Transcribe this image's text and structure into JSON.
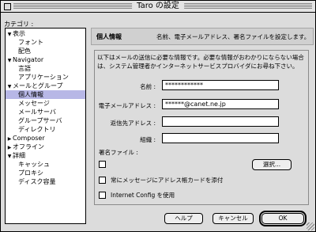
{
  "window": {
    "title": "Taro の設定"
  },
  "category": {
    "label": "カテゴリ :",
    "items": [
      {
        "label": "表示",
        "indent": 0,
        "disclosure": "down",
        "selected": false
      },
      {
        "label": "フォント",
        "indent": 1,
        "disclosure": "",
        "selected": false
      },
      {
        "label": "配色",
        "indent": 1,
        "disclosure": "",
        "selected": false
      },
      {
        "label": "Navigator",
        "indent": 0,
        "disclosure": "down",
        "selected": false
      },
      {
        "label": "言語",
        "indent": 1,
        "disclosure": "",
        "selected": false
      },
      {
        "label": "アプリケーション",
        "indent": 1,
        "disclosure": "",
        "selected": false
      },
      {
        "label": "メールとグループ",
        "indent": 0,
        "disclosure": "down",
        "selected": false
      },
      {
        "label": "個人情報",
        "indent": 1,
        "disclosure": "",
        "selected": true
      },
      {
        "label": "メッセージ",
        "indent": 1,
        "disclosure": "",
        "selected": false
      },
      {
        "label": "メールサーバ",
        "indent": 1,
        "disclosure": "",
        "selected": false
      },
      {
        "label": "グループサーバ",
        "indent": 1,
        "disclosure": "",
        "selected": false
      },
      {
        "label": "ディレクトリ",
        "indent": 1,
        "disclosure": "",
        "selected": false
      },
      {
        "label": "Composer",
        "indent": 0,
        "disclosure": "right",
        "selected": false
      },
      {
        "label": "オフライン",
        "indent": 0,
        "disclosure": "right",
        "selected": false
      },
      {
        "label": "詳細",
        "indent": 0,
        "disclosure": "down",
        "selected": false
      },
      {
        "label": "キャッシュ",
        "indent": 1,
        "disclosure": "",
        "selected": false
      },
      {
        "label": "プロキシ",
        "indent": 1,
        "disclosure": "",
        "selected": false
      },
      {
        "label": "ディスク容量",
        "indent": 1,
        "disclosure": "",
        "selected": false
      }
    ]
  },
  "panel": {
    "heading": "個人情報",
    "description": "名前、電子メールアドレス、署名ファイルを設定します。",
    "info_line1": "以下はメールの送信に必要な情報です。必要な情報がおわかりにならない場合",
    "info_line2": "は、システム管理者かインターネットサービスプロバイダにお尋ね下さい。"
  },
  "form": {
    "name_label": "名前 :",
    "name_value": "************",
    "email_label": "電子メールアドレス :",
    "email_value": "******@canet.ne.jp",
    "reply_label": "返信先アドレス :",
    "reply_value": "",
    "org_label": "組織 :",
    "org_value": ""
  },
  "signature": {
    "label": "署名ファイル :",
    "choose_button": "選択..."
  },
  "options": {
    "attach_card": "常にメッセージにアドレス帳カードを添付",
    "internet_config": "Internet Config を使用"
  },
  "buttons": {
    "help": "ヘルプ",
    "cancel": "キャンセル",
    "ok": "OK"
  }
}
